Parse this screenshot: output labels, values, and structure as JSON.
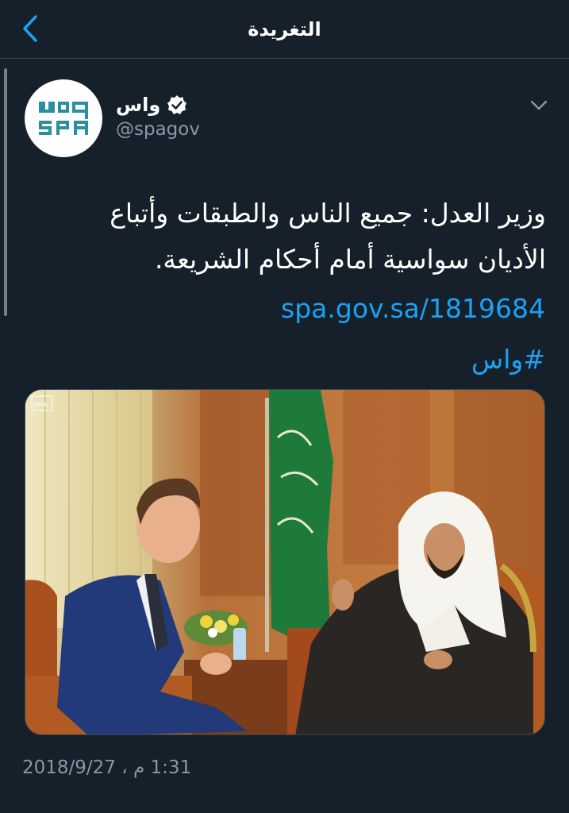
{
  "header": {
    "title": "التغريدة",
    "back_icon": "chevron-left-icon"
  },
  "tweet": {
    "author": {
      "name": "واس",
      "handle": "@spagov",
      "verified": true,
      "avatar_logo_text": [
        "واس",
        "SPA"
      ]
    },
    "menu_icon": "chevron-down-icon",
    "text_lines": [
      "وزير العدل: جميع الناس والطبقات وأتباع",
      "الأديان سواسية أمام أحكام الشريعة."
    ],
    "link": "spa.gov.sa/1819684",
    "hashtag": "#واس",
    "media_watermark": "SPA",
    "timestamp": "1:31 م ، 2018/9/27"
  },
  "colors": {
    "background": "#15202b",
    "accent": "#1da1f2",
    "secondary_text": "#8899a6",
    "divider": "#38444d",
    "spa_teal": "#2a8fa0"
  }
}
